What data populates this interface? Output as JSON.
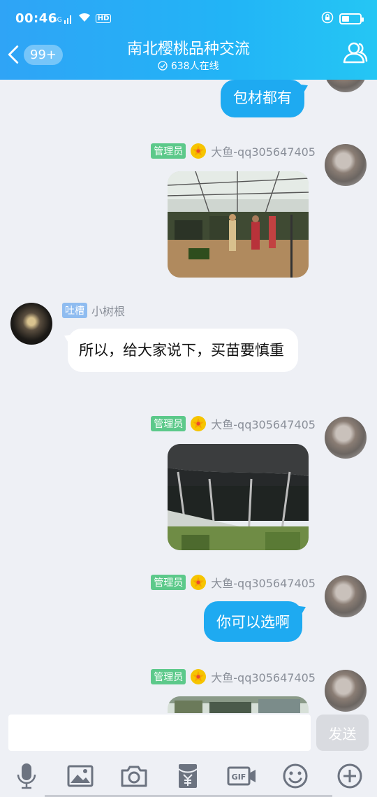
{
  "status_bar": {
    "time": "00:46",
    "signal_label": "4G",
    "hd_label": "HD",
    "battery_percent": 40
  },
  "header": {
    "back_badge": "99+",
    "title": "南北樱桃品种交流",
    "online_count": "638人在线"
  },
  "messages": [
    {
      "type": "text-out",
      "text": "包材都有"
    },
    {
      "type": "image-out",
      "tag": "管理员",
      "sender": "大鱼-qq305647405",
      "photo": "greenhouse-workers-photo"
    },
    {
      "type": "text-in",
      "tag": "吐槽",
      "sender": "小树根",
      "text": "所以，给大家说下，买苗要慎重"
    },
    {
      "type": "image-out",
      "tag": "管理员",
      "sender": "大鱼-qq305647405",
      "photo": "greenhouse-seedlings-photo"
    },
    {
      "type": "text-out",
      "tag": "管理员",
      "sender": "大鱼-qq305647405",
      "text": "你可以选啊"
    },
    {
      "type": "image-out",
      "tag": "管理员",
      "sender": "大鱼-qq305647405",
      "photo": "greenhouse-partial-photo"
    }
  ],
  "input": {
    "placeholder": "",
    "send_label": "发送"
  },
  "toolbar": {
    "items": [
      "voice-icon",
      "image-icon",
      "camera-icon",
      "red-packet-icon",
      "gif-icon",
      "emoji-icon",
      "plus-icon"
    ],
    "gif_label": "GIF"
  },
  "colors": {
    "header": "#22b4f6",
    "bubble_out": "#1eaaf1",
    "admin_tag": "#5cc98a",
    "tucao_tag": "#8fbcf0"
  }
}
